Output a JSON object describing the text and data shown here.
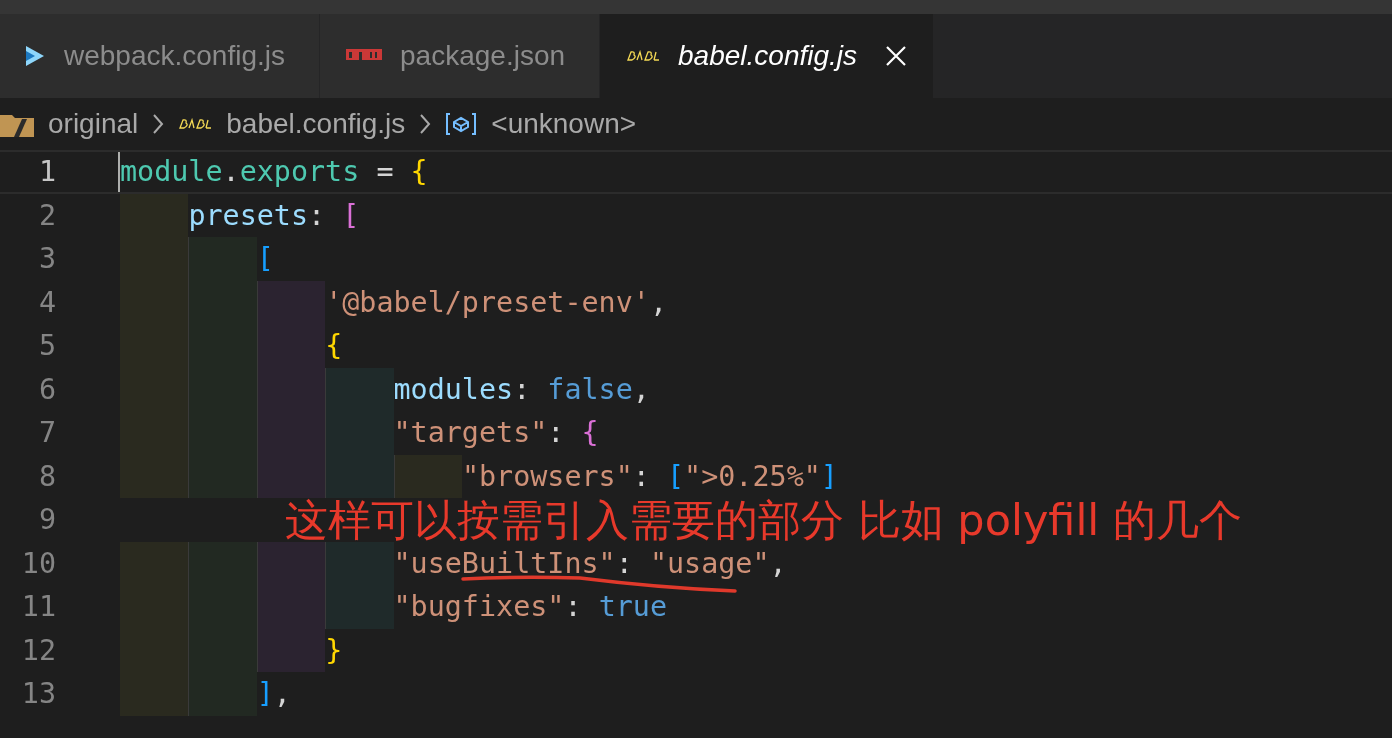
{
  "tabs": [
    {
      "label": "webpack.config.js",
      "selected": false,
      "preview": false
    },
    {
      "label": "package.json",
      "selected": false,
      "preview": false
    },
    {
      "label": "babel.config.js",
      "selected": true,
      "preview": true
    }
  ],
  "breadcrumb": [
    {
      "label": "original"
    },
    {
      "label": "babel.config.js"
    },
    {
      "label": "<unknown>"
    }
  ],
  "editor": {
    "lines": [
      {
        "number": "1",
        "current": true,
        "tokens": [
          {
            "text": "module",
            "kind": "variable"
          },
          {
            "text": ".",
            "kind": "punct"
          },
          {
            "text": "exports",
            "kind": "variable"
          },
          {
            "text": " = ",
            "kind": "punct"
          },
          {
            "text": "{",
            "kind": "bracket1"
          }
        ]
      },
      {
        "number": "2",
        "current": false,
        "tokens": [
          {
            "text": "    presets",
            "kind": "property"
          },
          {
            "text": ": ",
            "kind": "punct"
          },
          {
            "text": "[",
            "kind": "bracket2"
          }
        ]
      },
      {
        "number": "3",
        "current": false,
        "tokens": [
          {
            "text": "        [",
            "kind": "bracket3"
          }
        ]
      },
      {
        "number": "4",
        "current": false,
        "tokens": [
          {
            "text": "            '@babel/preset-env'",
            "kind": "string"
          },
          {
            "text": ",",
            "kind": "punct"
          }
        ]
      },
      {
        "number": "5",
        "current": false,
        "tokens": [
          {
            "text": "            {",
            "kind": "bracket1"
          }
        ]
      },
      {
        "number": "6",
        "current": false,
        "tokens": [
          {
            "text": "                modules",
            "kind": "property"
          },
          {
            "text": ": ",
            "kind": "punct"
          },
          {
            "text": "false",
            "kind": "keyword"
          },
          {
            "text": ",",
            "kind": "punct"
          }
        ]
      },
      {
        "number": "7",
        "current": false,
        "tokens": [
          {
            "text": "                \"targets\"",
            "kind": "string"
          },
          {
            "text": ": ",
            "kind": "punct"
          },
          {
            "text": "{",
            "kind": "bracket2"
          }
        ]
      },
      {
        "number": "8",
        "current": false,
        "tokens": [
          {
            "text": "                    \"browsers\"",
            "kind": "string"
          },
          {
            "text": ": ",
            "kind": "punct"
          },
          {
            "text": "[",
            "kind": "bracket3"
          },
          {
            "text": "\">0.25%\"",
            "kind": "string"
          },
          {
            "text": "]",
            "kind": "bracket3"
          }
        ]
      },
      {
        "number": "9",
        "current": false
      },
      {
        "number": "10",
        "current": false,
        "tokens": [
          {
            "text": "                \"useBuiltIns\"",
            "kind": "string"
          },
          {
            "text": ": ",
            "kind": "punct"
          },
          {
            "text": "\"usage\"",
            "kind": "string"
          },
          {
            "text": ",",
            "kind": "punct"
          }
        ]
      },
      {
        "number": "11",
        "current": false,
        "tokens": [
          {
            "text": "                \"bugfixes\"",
            "kind": "string"
          },
          {
            "text": ": ",
            "kind": "punct"
          },
          {
            "text": "true",
            "kind": "keyword"
          }
        ]
      },
      {
        "number": "12",
        "current": false,
        "tokens": [
          {
            "text": "            }",
            "kind": "bracket1"
          }
        ]
      },
      {
        "number": "13",
        "current": false,
        "tokens": [
          {
            "text": "        ]",
            "kind": "bracket3"
          },
          {
            "text": ",",
            "kind": "punct"
          }
        ]
      }
    ]
  },
  "annotation": {
    "text": "这样可以按需引入需要的部分 比如 polyfill 的几个"
  }
}
